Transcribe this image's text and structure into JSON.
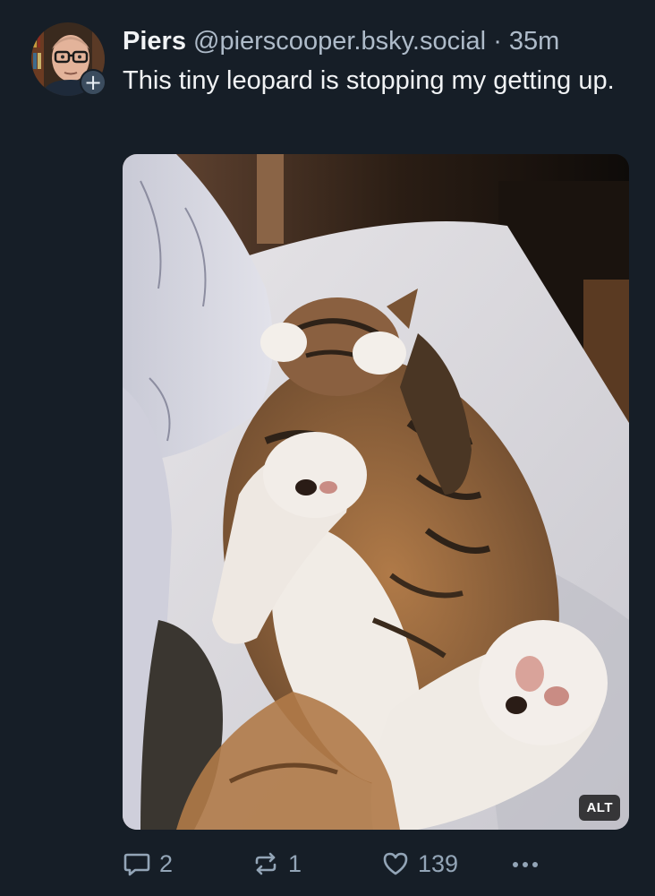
{
  "post": {
    "author": {
      "display_name": "Piers",
      "handle": "@pierscooper.bsky.social",
      "follow_symbol": "+"
    },
    "separator": "·",
    "time": "35m",
    "text": "This tiny leopard is stopping my getting up.",
    "media": {
      "alt_label": "ALT"
    },
    "actions": {
      "reply_count": "2",
      "repost_count": "1",
      "like_count": "139"
    }
  },
  "colors": {
    "background": "#161e27",
    "secondary_text": "#aebbc9",
    "action_icon": "#93a5b7"
  }
}
